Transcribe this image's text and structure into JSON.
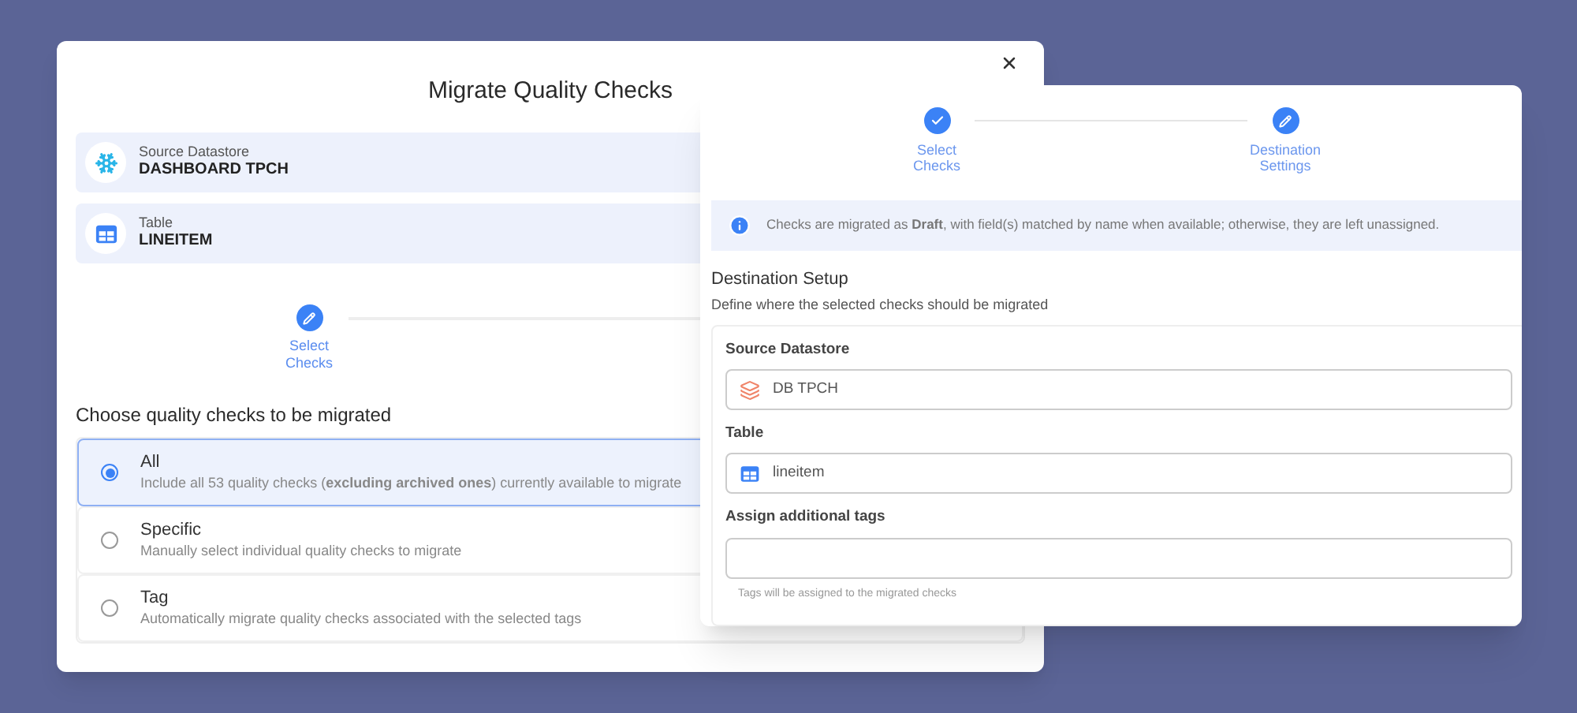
{
  "back_dialog": {
    "title": "Migrate Quality Checks",
    "source": {
      "label": "Source Datastore",
      "value": "DASHBOARD TPCH",
      "kind": "snowflake"
    },
    "table": {
      "label": "Table",
      "value": "LINEITEM",
      "kind": "table"
    },
    "step": {
      "label": "Select Checks",
      "kind": "current"
    },
    "question": "Choose quality checks to be migrated",
    "options": [
      {
        "title": "All",
        "description": "Include all 53 quality checks (**excluding archived ones**) currently available to migrate",
        "selected": true
      },
      {
        "title": "Specific",
        "description": "Manually select individual quality checks to migrate",
        "selected": false
      },
      {
        "title": "Tag",
        "description": "Automatically migrate quality checks associated with the selected tags",
        "selected": false
      }
    ]
  },
  "front_panel": {
    "steps": [
      {
        "label": "Select Checks",
        "kind": "done"
      },
      {
        "label": "Destination Settings",
        "kind": "current"
      }
    ],
    "info": "Checks are migrated as **Draft**, with field(s) matched by name when available; otherwise, they are left unassigned.",
    "section_title": "Destination Setup",
    "section_subtitle": "Define where the selected checks should be migrated",
    "fields": [
      {
        "label": "Source Datastore",
        "value": "DB TPCH",
        "kind": "database"
      },
      {
        "label": "Table",
        "value": "lineitem",
        "kind": "table"
      },
      {
        "label": "Assign additional tags",
        "kind": "tags",
        "helper": "Tags will be assigned to the migrated checks"
      }
    ]
  }
}
